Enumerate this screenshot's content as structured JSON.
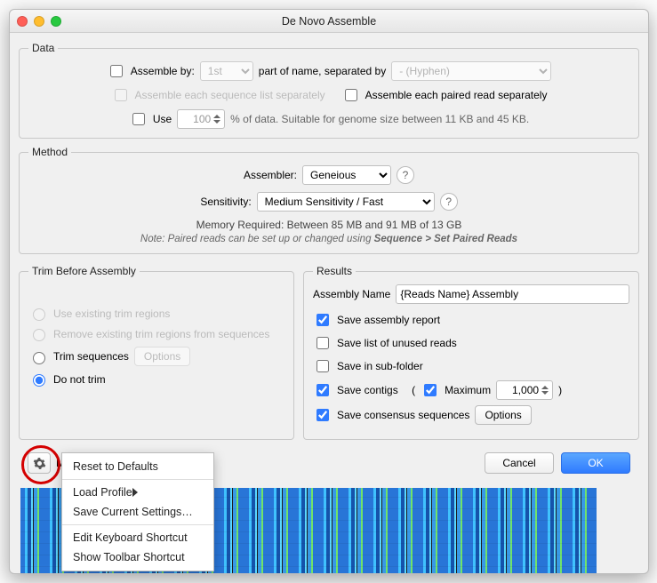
{
  "title": "De Novo Assemble",
  "data_section": {
    "legend": "Data",
    "assemble_by": "Assemble by:",
    "assemble_by_value": "1st",
    "assemble_by_suffix": "part of name, separated by",
    "separator_value": "- (Hyphen)",
    "assemble_each_seq": "Assemble each sequence list separately",
    "assemble_each_paired": "Assemble each paired read separately",
    "use_label": "Use",
    "use_value": "100",
    "use_suffix": "% of data. Suitable for genome size between 11 KB and 45 KB."
  },
  "method_section": {
    "legend": "Method",
    "assembler_label": "Assembler:",
    "assembler_value": "Geneious",
    "sensitivity_label": "Sensitivity:",
    "sensitivity_value": "Medium Sensitivity / Fast",
    "memory_text": "Memory Required: Between 85 MB and 91 MB of 13 GB",
    "note_prefix": "Note: Paired reads can be set up or changed using ",
    "note_bold": "Sequence > Set Paired Reads"
  },
  "trim_section": {
    "legend": "Trim Before Assembly",
    "opt_existing": "Use existing trim regions",
    "opt_remove": "Remove existing trim regions from sequences",
    "opt_trim": "Trim sequences",
    "opt_trim_btn": "Options",
    "opt_donot": "Do not trim"
  },
  "results_section": {
    "legend": "Results",
    "name_label": "Assembly Name",
    "name_value": "{Reads Name} Assembly",
    "save_report": "Save assembly report",
    "save_unused": "Save list of unused reads",
    "save_subfolder": "Save in sub-folder",
    "save_contigs_prefix": "Save contigs",
    "save_contigs_paren_open": "(",
    "maximum_label": "Maximum",
    "maximum_value": "1,000",
    "save_contigs_paren_close": ")",
    "save_consensus": "Save consensus sequences",
    "options_btn": "Options"
  },
  "footer": {
    "more_options": "More Options",
    "cancel": "Cancel",
    "ok": "OK"
  },
  "menu": {
    "reset": "Reset to Defaults",
    "load": "Load Profile",
    "save": "Save Current Settings…",
    "edit_kb": "Edit Keyboard Shortcut",
    "show_tb": "Show Toolbar Shortcut"
  }
}
